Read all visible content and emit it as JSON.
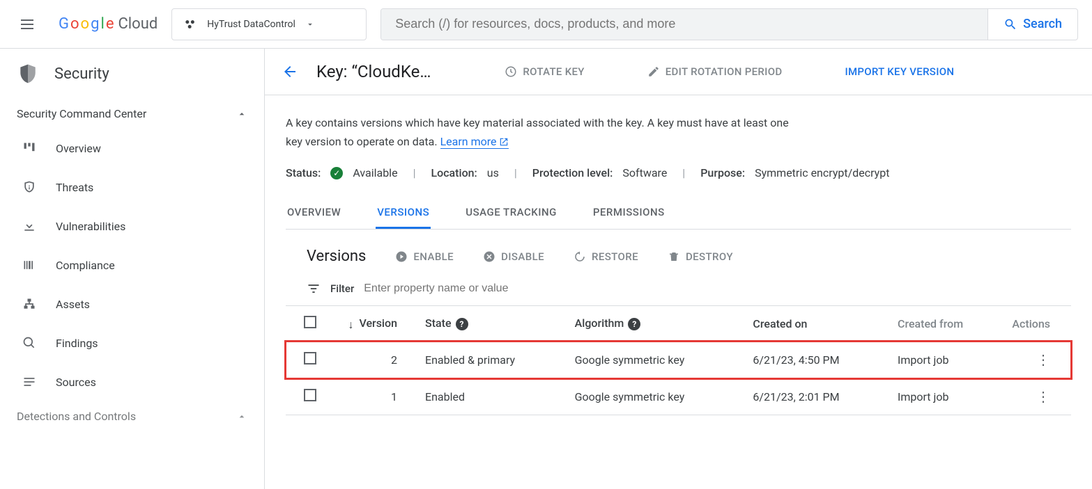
{
  "topbar": {
    "project": "HyTrust DataControl",
    "search_placeholder": "Search (/) for resources, docs, products, and more",
    "search_button": "Search"
  },
  "logo_cloud": "Cloud",
  "sidebar": {
    "title": "Security",
    "sections": [
      {
        "label": "Security Command Center",
        "expanded": true
      },
      {
        "label": "Detections and Controls",
        "expanded": true
      }
    ],
    "items": [
      {
        "label": "Overview"
      },
      {
        "label": "Threats"
      },
      {
        "label": "Vulnerabilities"
      },
      {
        "label": "Compliance"
      },
      {
        "label": "Assets"
      },
      {
        "label": "Findings"
      },
      {
        "label": "Sources"
      }
    ]
  },
  "page": {
    "title": "Key: “CloudKe…",
    "actions": {
      "rotate": "ROTATE KEY",
      "edit": "EDIT ROTATION PERIOD",
      "import": "IMPORT KEY VERSION"
    },
    "description_1": "A key contains versions which have key material associated with the key. A key must have at least one key version to operate on data. ",
    "learn_more": "Learn more",
    "meta": {
      "status_label": "Status:",
      "status_value": "Available",
      "location_label": "Location:",
      "location_value": "us",
      "protection_label": "Protection level:",
      "protection_value": "Software",
      "purpose_label": "Purpose:",
      "purpose_value": "Symmetric encrypt/decrypt"
    },
    "tabs": [
      "OVERVIEW",
      "VERSIONS",
      "USAGE TRACKING",
      "PERMISSIONS"
    ],
    "active_tab": 1
  },
  "versions": {
    "title": "Versions",
    "buttons": {
      "enable": "ENABLE",
      "disable": "DISABLE",
      "restore": "RESTORE",
      "destroy": "DESTROY"
    },
    "filter_label": "Filter",
    "filter_placeholder": "Enter property name or value",
    "columns": {
      "version": "Version",
      "state": "State",
      "algorithm": "Algorithm",
      "created": "Created on",
      "from": "Created from",
      "actions": "Actions"
    },
    "rows": [
      {
        "version": "2",
        "state": "Enabled & primary",
        "algorithm": "Google symmetric key",
        "created": "6/21/23, 4:50 PM",
        "from": "Import job",
        "highlight": true
      },
      {
        "version": "1",
        "state": "Enabled",
        "algorithm": "Google symmetric key",
        "created": "6/21/23, 2:01 PM",
        "from": "Import job",
        "highlight": false
      }
    ]
  }
}
